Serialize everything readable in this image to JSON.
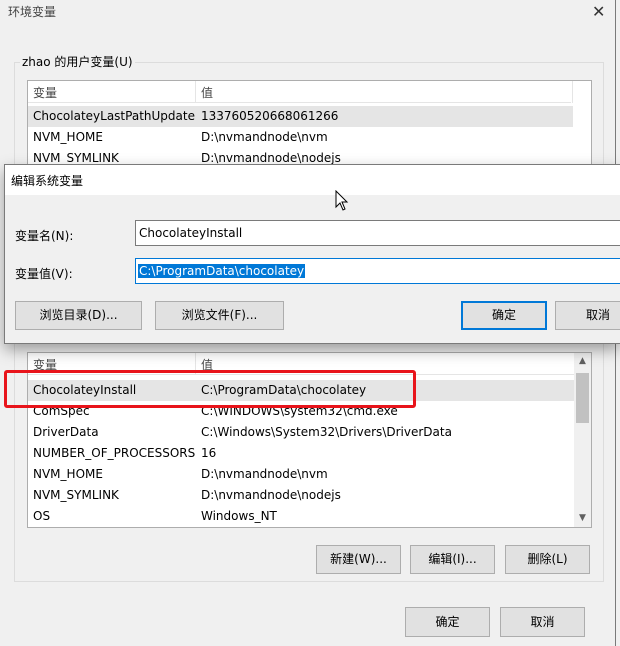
{
  "window": {
    "title": "环境变量",
    "close_glyph": "✕"
  },
  "user_vars": {
    "group_label": "zhao 的用户变量(U)",
    "headers": [
      "变量",
      "值"
    ],
    "rows": [
      {
        "name": "ChocolateyLastPathUpdate",
        "value": "133760520668061266"
      },
      {
        "name": "NVM_HOME",
        "value": "D:\\nvmandnode\\nvm"
      },
      {
        "name": "NVM_SYMLINK",
        "value": "D:\\nvmandnode\\nodejs"
      }
    ]
  },
  "edit_dialog": {
    "title": "编辑系统变量",
    "name_label": "变量名(N):",
    "name_value": "ChocolateyInstall",
    "value_label": "变量值(V):",
    "value_value": "C:\\ProgramData\\chocolatey",
    "browse_dir": "浏览目录(D)...",
    "browse_file": "浏览文件(F)...",
    "ok": "确定",
    "cancel": "取消"
  },
  "system_vars": {
    "headers": [
      "变量",
      "值"
    ],
    "rows": [
      {
        "name": "ChocolateyInstall",
        "value": "C:\\ProgramData\\chocolatey"
      },
      {
        "name": "ComSpec",
        "value": "C:\\WINDOWS\\system32\\cmd.exe"
      },
      {
        "name": "DriverData",
        "value": "C:\\Windows\\System32\\Drivers\\DriverData"
      },
      {
        "name": "NUMBER_OF_PROCESSORS",
        "value": "16"
      },
      {
        "name": "NVM_HOME",
        "value": "D:\\nvmandnode\\nvm"
      },
      {
        "name": "NVM_SYMLINK",
        "value": "D:\\nvmandnode\\nodejs"
      },
      {
        "name": "OS",
        "value": "Windows_NT"
      }
    ],
    "new_btn": "新建(W)...",
    "edit_btn": "编辑(I)...",
    "delete_btn": "删除(L)"
  },
  "footer": {
    "ok": "确定",
    "cancel": "取消"
  },
  "colors": {
    "highlight": "#e8141b",
    "accent": "#0078d7"
  }
}
